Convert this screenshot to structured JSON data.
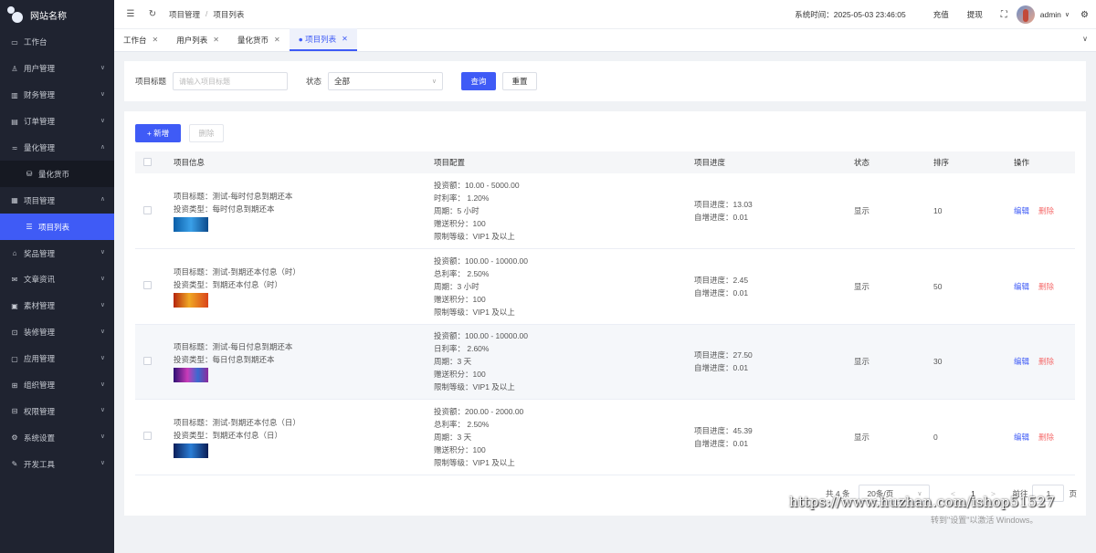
{
  "brand": {
    "name": "网站名称"
  },
  "sidebar": {
    "items": [
      {
        "label": "工作台",
        "icon": "monitor-icon"
      },
      {
        "label": "用户管理",
        "icon": "user-icon",
        "chevron": "v"
      },
      {
        "label": "财务管理",
        "icon": "chart-icon",
        "chevron": "v"
      },
      {
        "label": "订单管理",
        "icon": "order-icon",
        "chevron": "v"
      },
      {
        "label": "量化管理",
        "icon": "quant-icon",
        "chevron": "^"
      },
      {
        "label": "量化货币",
        "icon": "database-icon",
        "sub": true
      },
      {
        "label": "项目管理",
        "icon": "project-icon",
        "chevron": "^"
      },
      {
        "label": "项目列表",
        "icon": "list-icon",
        "active": true
      },
      {
        "label": "奖品管理",
        "icon": "gift-icon",
        "chevron": "v"
      },
      {
        "label": "文章资讯",
        "icon": "article-icon",
        "chevron": "v"
      },
      {
        "label": "素材管理",
        "icon": "image-icon",
        "chevron": "v"
      },
      {
        "label": "装修管理",
        "icon": "decor-icon",
        "chevron": "v"
      },
      {
        "label": "应用管理",
        "icon": "app-icon",
        "chevron": "v"
      },
      {
        "label": "组织管理",
        "icon": "org-icon",
        "chevron": "v"
      },
      {
        "label": "权限管理",
        "icon": "lock-icon",
        "chevron": "v"
      },
      {
        "label": "系统设置",
        "icon": "gear-icon",
        "chevron": "v"
      },
      {
        "label": "开发工具",
        "icon": "tool-icon",
        "chevron": "v"
      }
    ]
  },
  "header": {
    "breadcrumb": [
      "项目管理",
      "项目列表"
    ],
    "system_time": "系统时间：2025-05-03 23:46:05",
    "recharge": "充值",
    "withdraw": "提现",
    "user": "admin"
  },
  "tabs": [
    {
      "label": "工作台",
      "active": false
    },
    {
      "label": "用户列表",
      "active": false
    },
    {
      "label": "量化货币",
      "active": false
    },
    {
      "label": "● 项目列表",
      "active": true
    }
  ],
  "search": {
    "title_label": "项目标题",
    "title_placeholder": "请输入项目标题",
    "status_label": "状态",
    "status_value": "全部",
    "query_btn": "查询",
    "reset_btn": "重置"
  },
  "toolbar": {
    "add_btn": "+ 新增",
    "delete_btn": "删除"
  },
  "table": {
    "headers": [
      "项目信息",
      "项目配置",
      "项目进度",
      "状态",
      "排序",
      "操作"
    ],
    "rows": [
      {
        "info": [
          "项目标题：测试-每时付息到期还本",
          "投资类型：每时付息到期还本"
        ],
        "thumb": "t1",
        "config": [
          "投资额：10.00 - 5000.00",
          "时利率：  1.20%",
          "周期：5 小时",
          "赠送积分：100",
          "限制等级：VIP1 及以上"
        ],
        "progress": [
          "项目进度：13.03",
          "自增进度：0.01"
        ],
        "status": "显示",
        "sort": "10"
      },
      {
        "info": [
          "项目标题：测试-到期还本付息（时）",
          "投资类型：到期还本付息（时）"
        ],
        "thumb": "t2",
        "config": [
          "投资额：100.00 - 10000.00",
          "总利率：  2.50%",
          "周期：3 小时",
          "赠送积分：100",
          "限制等级：VIP1 及以上"
        ],
        "progress": [
          "项目进度：2.45",
          "自增进度：0.01"
        ],
        "status": "显示",
        "sort": "50"
      },
      {
        "info": [
          "项目标题：测试-每日付息到期还本",
          "投资类型：每日付息到期还本"
        ],
        "thumb": "t3",
        "config": [
          "投资额：100.00 - 10000.00",
          "日利率：  2.60%",
          "周期：3 天",
          "赠送积分：100",
          "限制等级：VIP1 及以上"
        ],
        "progress": [
          "项目进度：27.50",
          "自增进度：0.01"
        ],
        "status": "显示",
        "sort": "30"
      },
      {
        "info": [
          "项目标题：测试-到期还本付息（日）",
          "投资类型：到期还本付息（日）"
        ],
        "thumb": "t4",
        "config": [
          "投资额：200.00 - 2000.00",
          "总利率：  2.50%",
          "周期：3 天",
          "赠送积分：100",
          "限制等级：VIP1 及以上"
        ],
        "progress": [
          "项目进度：45.39",
          "自增进度：0.01"
        ],
        "status": "显示",
        "sort": "0"
      }
    ],
    "edit_label": "编辑",
    "delete_label": "删除"
  },
  "pager": {
    "total": "共 4 条",
    "page_size": "20条/页",
    "prev": "<",
    "page": "1",
    "next": ">",
    "goto": "前往",
    "goto_value": "1",
    "suffix": "页"
  },
  "overlay": {
    "watermark": "https://www.huzhan.com/ishop51527",
    "activation": "转到\"设置\"以激活 Windows。"
  }
}
